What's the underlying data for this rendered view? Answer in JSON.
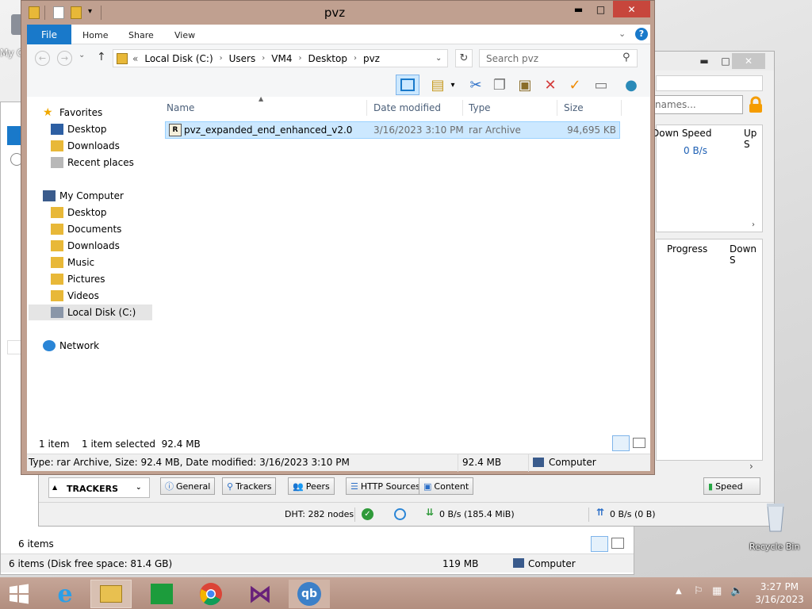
{
  "desktop": {
    "partial_label": "My C",
    "recycle_bin": "Recycle Bin"
  },
  "back_explorer": {
    "items_count": "6 items",
    "status_left": "6 items (Disk free space: 81.4 GB)",
    "status_size": "119 MB",
    "status_location": "Computer"
  },
  "qbittorrent": {
    "search_placeholder": "names...",
    "table1_headers": [
      "Down Speed",
      "Up S"
    ],
    "table1_row": "0 B/s",
    "table2_headers": [
      "Progress",
      "Down S"
    ],
    "trackers_label": "TRACKERS",
    "tabs": [
      "General",
      "Trackers",
      "Peers",
      "HTTP Sources",
      "Content"
    ],
    "speed_button": "Speed",
    "status": {
      "dht": "DHT: 282 nodes",
      "down": "0 B/s (185.4 MiB)",
      "up": "0 B/s (0 B)"
    }
  },
  "explorer": {
    "title": "pvz",
    "ribbon_tabs": {
      "file": "File",
      "home": "Home",
      "share": "Share",
      "view": "View"
    },
    "breadcrumb": [
      "Local Disk (C:)",
      "Users",
      "VM4",
      "Desktop",
      "pvz"
    ],
    "breadcrumb_prefix": "«",
    "search_placeholder": "Search pvz",
    "nav": {
      "favorites": "Favorites",
      "fav_items": [
        "Desktop",
        "Downloads",
        "Recent places"
      ],
      "computer": "My Computer",
      "computer_items": [
        "Desktop",
        "Documents",
        "Downloads",
        "Music",
        "Pictures",
        "Videos",
        "Local Disk (C:)"
      ],
      "network": "Network"
    },
    "columns": {
      "name": "Name",
      "date": "Date modified",
      "type": "Type",
      "size": "Size"
    },
    "files": [
      {
        "name": "pvz_expanded_end_enhanced_v2.0",
        "date": "3/16/2023 3:10 PM",
        "type": "rar Archive",
        "size": "94,695 KB"
      }
    ],
    "status": {
      "count": "1 item",
      "selected": "1 item selected  92.4 MB"
    },
    "details": {
      "info": "Type: rar Archive, Size: 92.4 MB, Date modified: 3/16/2023 3:10 PM",
      "size": "92.4 MB",
      "location": "Computer"
    }
  },
  "taskbar": {
    "time": "3:27 PM",
    "date": "3/16/2023"
  },
  "colors": {
    "accent": "#1979ca",
    "window_frame": "#c0a090",
    "close": "#c7463c",
    "selection": "#cce8ff"
  }
}
